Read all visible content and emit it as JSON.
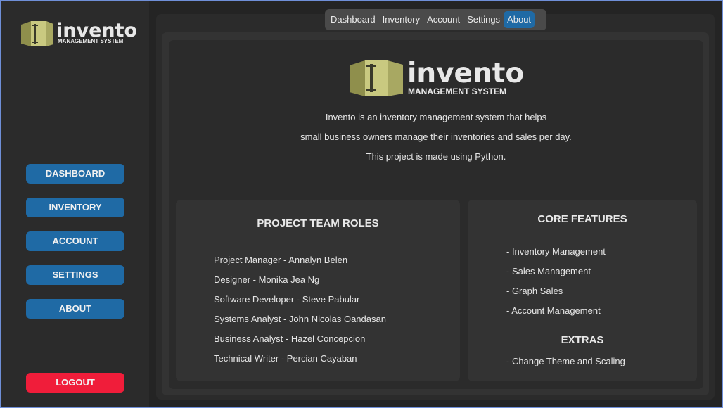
{
  "brand": {
    "name": "invento",
    "tagline": "MANAGEMENT SYSTEM",
    "box_light": "#c9c980",
    "box_dark": "#8f8f4c"
  },
  "sidebar": {
    "buttons": [
      {
        "label": "DASHBOARD"
      },
      {
        "label": "INVENTORY"
      },
      {
        "label": "ACCOUNT"
      },
      {
        "label": "SETTINGS"
      },
      {
        "label": "ABOUT"
      }
    ],
    "logout_label": "LOGOUT"
  },
  "tabs": [
    {
      "label": "Dashboard"
    },
    {
      "label": "Inventory"
    },
    {
      "label": "Account"
    },
    {
      "label": "Settings"
    },
    {
      "label": "About",
      "active": true
    }
  ],
  "about": {
    "description": [
      "Invento is an inventory management system that helps",
      "small business owners manage their inventories and sales per day.",
      "This project is made using Python."
    ],
    "team": {
      "title": "PROJECT TEAM ROLES",
      "members": [
        "Project Manager - Annalyn Belen",
        "Designer - Monika Jea Ng",
        "Software Developer - Steve Pabular",
        "Systems Analyst - John Nicolas Oandasan",
        "Business Analyst - Hazel Concepcion",
        "Technical Writer - Percian Cayaban"
      ]
    },
    "features": {
      "title": "CORE FEATURES",
      "items": [
        "- Inventory Management",
        "- Sales Management",
        "- Graph Sales",
        "- Account Management"
      ],
      "extras_title": "EXTRAS",
      "extras": [
        "- Change Theme and Scaling"
      ]
    }
  },
  "colors": {
    "accent": "#1f6aa5",
    "logout": "#f01d3a"
  }
}
